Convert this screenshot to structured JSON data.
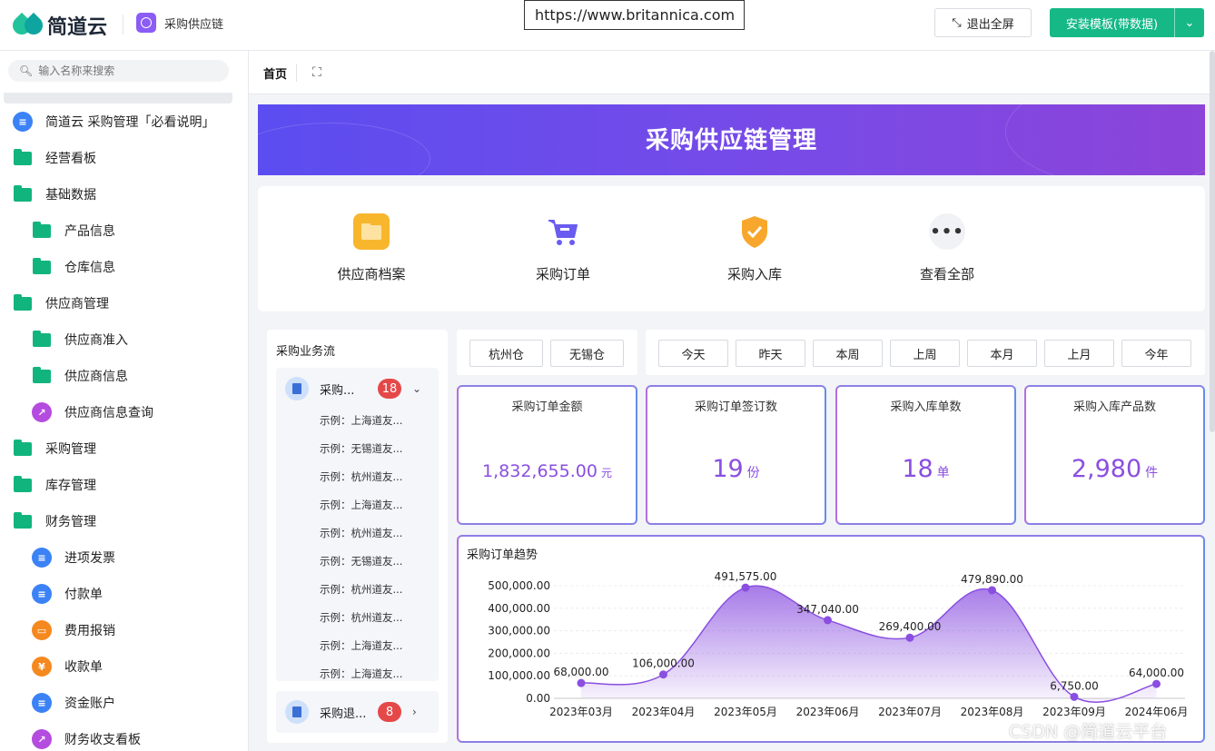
{
  "topbar": {
    "brand": "简道云",
    "app_name": "采购供应链",
    "app_icon": "scm-icon",
    "url": "https://www.britannica.com",
    "exit_fullscreen": "退出全屏",
    "install": "安装模板(带数据)"
  },
  "sidebar": {
    "search_placeholder": "输入名称来搜索",
    "items": [
      {
        "label": "简道云 采购管理「必看说明」",
        "icon": "doc-icon",
        "level": 0,
        "color": "#3b82f6"
      },
      {
        "label": "经营看板",
        "icon": "folder-icon",
        "level": 0
      },
      {
        "label": "基础数据",
        "icon": "folder-open-icon",
        "level": 0
      },
      {
        "label": "产品信息",
        "icon": "folder-icon",
        "level": 1
      },
      {
        "label": "仓库信息",
        "icon": "folder-icon",
        "level": 1
      },
      {
        "label": "供应商管理",
        "icon": "folder-open-icon",
        "level": 0
      },
      {
        "label": "供应商准入",
        "icon": "folder-icon",
        "level": 1
      },
      {
        "label": "供应商信息",
        "icon": "folder-icon",
        "level": 1
      },
      {
        "label": "供应商信息查询",
        "icon": "chart-icon",
        "level": 1,
        "color": "#b44ce0"
      },
      {
        "label": "采购管理",
        "icon": "folder-icon",
        "level": 0
      },
      {
        "label": "库存管理",
        "icon": "folder-icon",
        "level": 0
      },
      {
        "label": "财务管理",
        "icon": "folder-open-icon",
        "level": 0
      },
      {
        "label": "进项发票",
        "icon": "doc-icon",
        "level": 1,
        "color": "#3b82f6"
      },
      {
        "label": "付款单",
        "icon": "doc-icon",
        "level": 1,
        "color": "#3b82f6"
      },
      {
        "label": "费用报销",
        "icon": "wallet-icon",
        "level": 1,
        "color": "#f5891f"
      },
      {
        "label": "收款单",
        "icon": "receipt-icon",
        "level": 1,
        "color": "#f5891f"
      },
      {
        "label": "资金账户",
        "icon": "doc-icon",
        "level": 1,
        "color": "#3b82f6"
      },
      {
        "label": "财务收支看板",
        "icon": "chart-icon",
        "level": 1,
        "color": "#b44ce0"
      }
    ]
  },
  "tabbar": {
    "home": "首页"
  },
  "banner": {
    "title": "采购供应链管理"
  },
  "quick": [
    {
      "label": "供应商档案",
      "icon": "folder-card-icon",
      "color": "#f8b62d"
    },
    {
      "label": "采购订单",
      "icon": "cart-icon",
      "color": "#6a5cf0"
    },
    {
      "label": "采购入库",
      "icon": "shield-check-icon",
      "color": "#f8a72d"
    },
    {
      "label": "查看全部",
      "icon": "more-icon",
      "color": "#f1f2f5"
    }
  ],
  "flow": {
    "title": "采购业务流",
    "group1": {
      "name": "采购...",
      "count": "18",
      "subs": [
        "示例：上海道友...",
        "示例：无锡道友...",
        "示例：杭州道友...",
        "示例：上海道友...",
        "示例：杭州道友...",
        "示例：无锡道友...",
        "示例：杭州道友...",
        "示例：杭州道友...",
        "示例：上海道友...",
        "示例：上海道友..."
      ]
    },
    "group2": {
      "name": "采购退...",
      "count": "8"
    }
  },
  "filters": {
    "warehouses": [
      "杭州仓",
      "无锡仓"
    ],
    "periods": [
      "今天",
      "昨天",
      "本周",
      "上周",
      "本月",
      "上月",
      "今年"
    ]
  },
  "stats": [
    {
      "title": "采购订单金额",
      "value": "1,832,655.00",
      "unit": "元"
    },
    {
      "title": "采购订单签订数",
      "value": "19",
      "unit": "份"
    },
    {
      "title": "采购入库单数",
      "value": "18",
      "unit": "单"
    },
    {
      "title": "采购入库产品数",
      "value": "2,980",
      "unit": "件"
    }
  ],
  "watermark": "CSDN @简道云平台",
  "chart_data": {
    "type": "area",
    "title": "采购订单趋势",
    "categories": [
      "2023年03月",
      "2023年04月",
      "2023年05月",
      "2023年06月",
      "2023年07月",
      "2023年08月",
      "2023年09月",
      "2024年06月"
    ],
    "values": [
      68000,
      106000,
      491575,
      347040,
      269400,
      479890,
      6750,
      64000
    ],
    "labels": [
      "68,000.00",
      "106,000.00",
      "491,575.00",
      "347,040.00",
      "269,400.00",
      "479,890.00",
      "6,750.00",
      "64,000.00"
    ],
    "yticks": [
      "0.00",
      "100,000.00",
      "200,000.00",
      "300,000.00",
      "400,000.00",
      "500,000.00"
    ],
    "ylim": [
      0,
      500000
    ],
    "color": "#8a4fe0",
    "grid": true
  }
}
